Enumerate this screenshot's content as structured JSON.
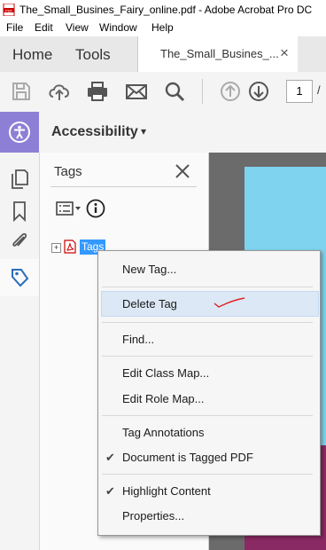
{
  "window": {
    "title": "The_Small_Busines_Fairy_online.pdf - Adobe Acrobat Pro DC"
  },
  "menubar": [
    "File",
    "Edit",
    "View",
    "Window",
    "Help"
  ],
  "tabs": {
    "home": "Home",
    "tools": "Tools",
    "document": "The_Small_Busines_...",
    "close": "×"
  },
  "toolbar": {
    "icons": [
      "save-icon",
      "upload-cloud-icon",
      "print-icon",
      "email-icon",
      "search-icon",
      "page-up-icon",
      "page-down-icon"
    ],
    "page_number": "1",
    "page_sep": "/"
  },
  "accessibility": {
    "label": "Accessibility",
    "caret": "▾"
  },
  "tags_panel": {
    "title": "Tags",
    "root_label": "Tags",
    "expander": "+"
  },
  "context_menu": {
    "items": [
      {
        "label": "New Tag...",
        "checked": false
      },
      {
        "label": "Delete Tag",
        "checked": false,
        "highlighted": true
      },
      {
        "label": "Find...",
        "checked": false
      },
      {
        "label": "Edit Class Map...",
        "checked": false
      },
      {
        "label": "Edit Role Map...",
        "checked": false
      },
      {
        "label": "Tag Annotations",
        "checked": false
      },
      {
        "label": "Document is Tagged PDF",
        "checked": true
      },
      {
        "label": "Highlight Content",
        "checked": true
      },
      {
        "label": "Properties...",
        "checked": false
      }
    ],
    "check_glyph": "✔"
  },
  "colors": {
    "accent_purple": "#8e7fd6",
    "selection_blue": "#3399ff",
    "highlight_row": "#dce8f5",
    "annotation_red": "#e02020",
    "doc_cyan": "#7fd3ee",
    "doc_magenta": "#8a2a64"
  }
}
